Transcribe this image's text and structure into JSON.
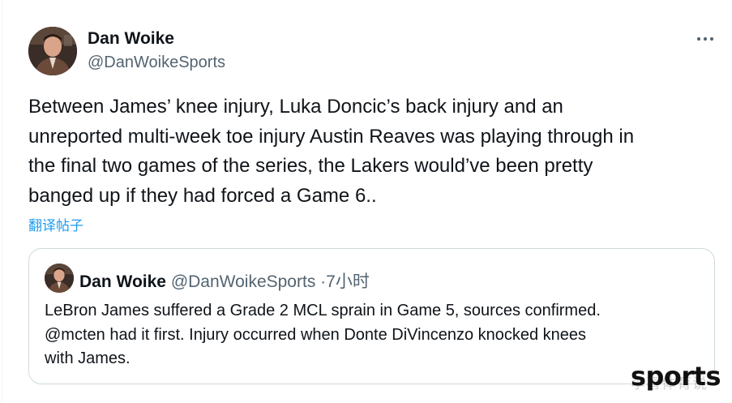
{
  "author": {
    "display_name": "Dan Woike",
    "handle": "@DanWoikeSports",
    "avatar_icon": "profile-photo"
  },
  "menu": {
    "icon": "more-options-icon"
  },
  "tweet": {
    "text": "Between James’ knee injury, Luka Doncic’s back injury and an\nunreported multi-week toe injury Austin Reaves was playing through in\nthe final two games of the series, the Lakers would’ve been pretty\nbanged up if they had forced a Game 6..",
    "translate_label": "翻译帖子"
  },
  "quote": {
    "display_name": "Dan Woike",
    "handle": "@DanWoikeSports",
    "separator": "·",
    "time": "7小时",
    "text": "LeBron James suffered a Grade 2 MCL sprain in Game 5, sources confirmed.\n@mcten had it first. Injury occurred when Donte DiVincenzo knocked knees\nwith James."
  },
  "watermark": {
    "cn": "李喜体育说",
    "en": "sports"
  },
  "colors": {
    "text_primary": "#0f1419",
    "text_secondary": "#536471",
    "link": "#1d9bf0",
    "border": "#cfd9de"
  }
}
